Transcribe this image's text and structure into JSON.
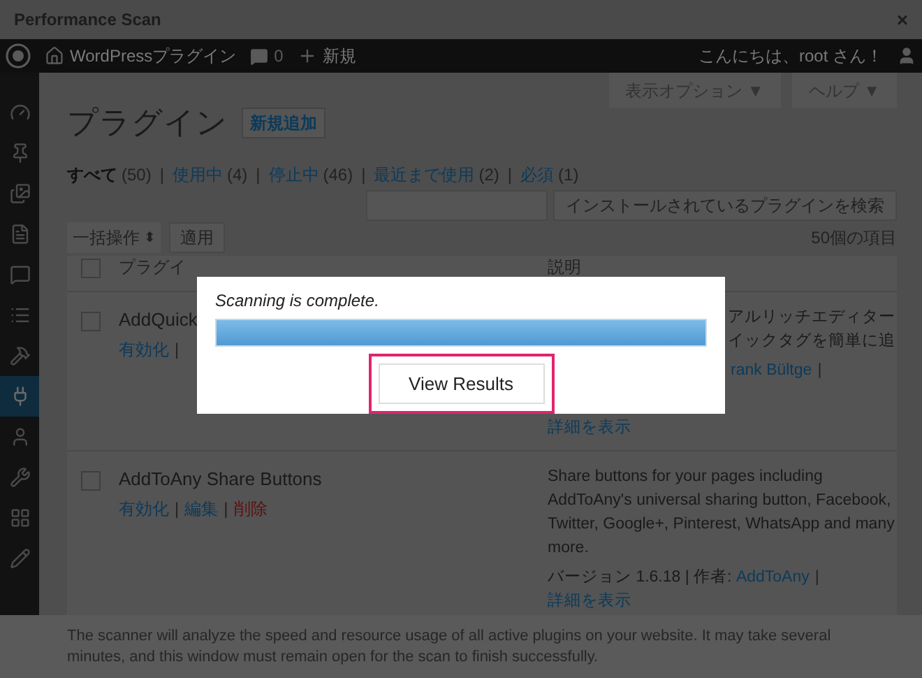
{
  "dialog": {
    "title": "Performance Scan",
    "close": "×"
  },
  "admin_bar": {
    "site": "WordPressプラグイン",
    "comments": "0",
    "new": "新規",
    "greeting": "こんにちは、root さん！"
  },
  "sidebar_items": [
    {
      "selected": false
    },
    {
      "selected": false
    },
    {
      "selected": false
    },
    {
      "selected": false
    },
    {
      "selected": false
    },
    {
      "selected": false
    },
    {
      "selected": false
    },
    {
      "selected": true
    },
    {
      "selected": false
    },
    {
      "selected": false
    },
    {
      "selected": false
    },
    {
      "selected": false
    }
  ],
  "screen_options": "表示オプション ▼",
  "help": "ヘルプ ▼",
  "page_title": "プラグイン",
  "add_new": "新規追加",
  "filter_separator": "|",
  "filters": [
    {
      "label": "すべて",
      "count": "(50)",
      "selected": true
    },
    {
      "label": "使用中",
      "count": "(4)",
      "selected": false
    },
    {
      "label": "停止中",
      "count": "(46)",
      "selected": false
    },
    {
      "label": "最近まで使用",
      "count": "(2)",
      "selected": false
    },
    {
      "label": "必須",
      "count": "(1)",
      "selected": false
    }
  ],
  "search_button": "インストールされているプラグインを検索",
  "bulk_action": "一括操作",
  "bulk_caret": "⬍",
  "apply": "適用",
  "item_count": "50個の項目",
  "select_all_checked": false,
  "columns": [
    "プラグイ",
    "説明"
  ],
  "plugins": [
    {
      "name": "AddQuick",
      "checked": false,
      "kind": "covered",
      "actions": [
        {
          "label": "有効化",
          "kind": "link"
        }
      ],
      "trailing_separator": "|",
      "description_lines": [
        "アルリッチエディター",
        "イックタグを簡単に追"
      ],
      "author": "rank Bültge",
      "meta_separator": "|",
      "details": "詳細を表示"
    },
    {
      "name": "AddToAny Share Buttons",
      "checked": false,
      "kind": "full",
      "actions": [
        {
          "label": "有効化",
          "kind": "link"
        },
        {
          "label": "編集",
          "kind": "link"
        },
        {
          "label": "削除",
          "kind": "delete"
        }
      ],
      "action_separator": "|",
      "description_lines": [
        "Share buttons for your pages including AddToAny's universal sharing button, Facebook, Twitter, Google+, Pinterest, WhatsApp and many more."
      ],
      "version": "バージョン 1.6.18 | 作者: ",
      "author": "AddToAny",
      "meta_separator": "|",
      "details": "詳細を表示"
    }
  ],
  "modal": {
    "status": "Scanning is complete.",
    "progress": {
      "level": 1
    },
    "button": "View Results",
    "button_highlighted": true
  },
  "footer": "The scanner will analyze the speed and resource usage of all active plugins on your website. It may take several minutes, and this window must remain open for the scan to finish successfully."
}
